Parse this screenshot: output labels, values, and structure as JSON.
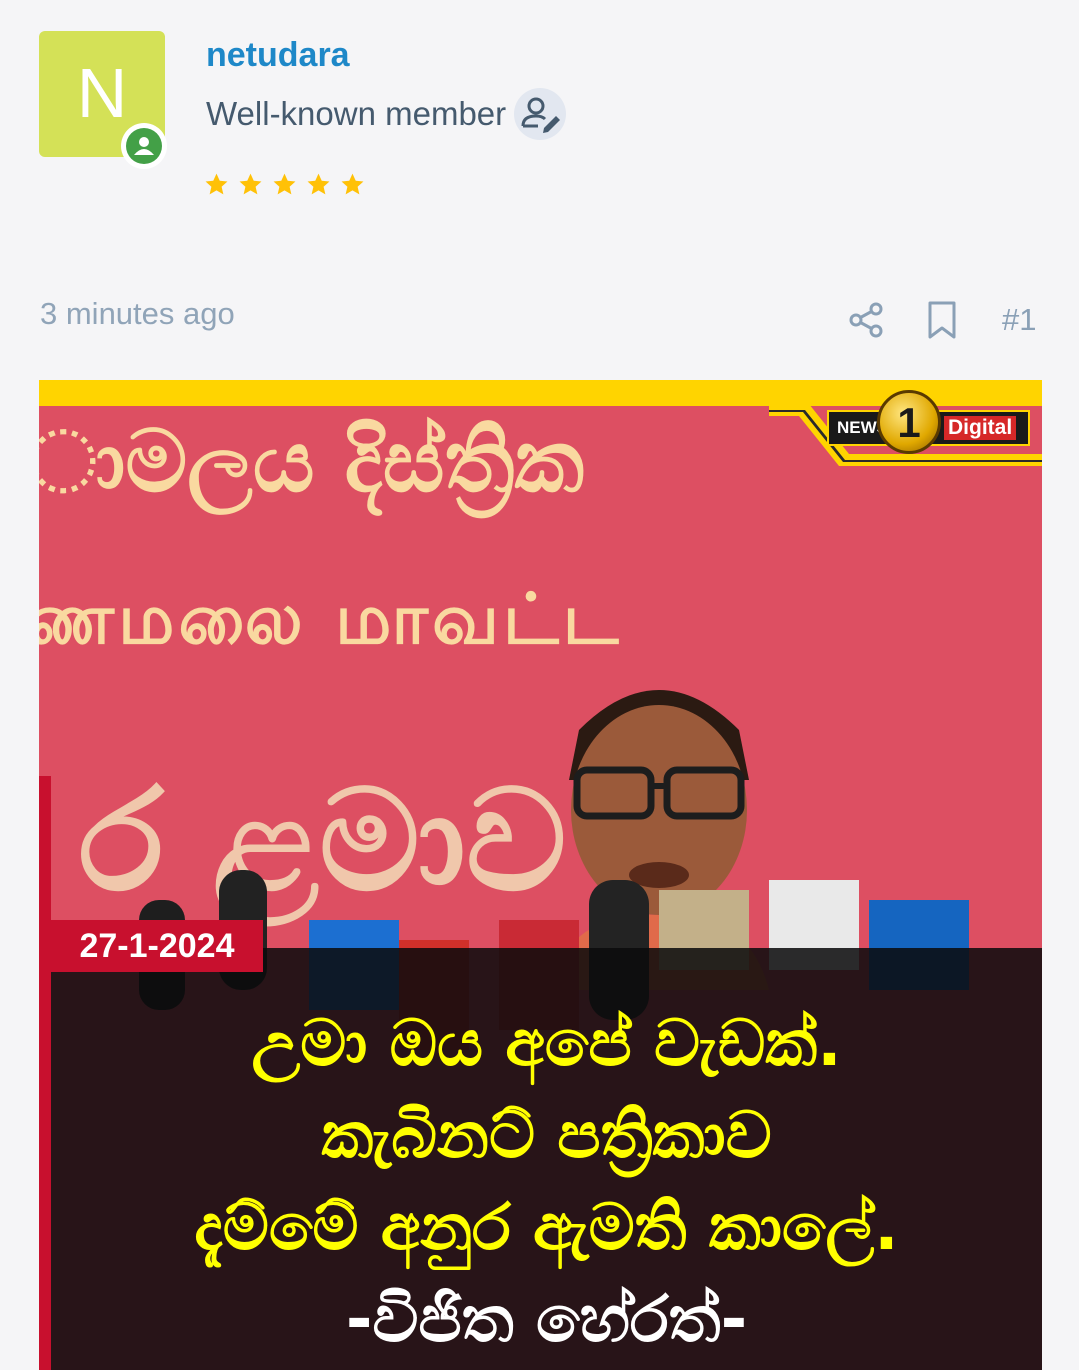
{
  "user": {
    "avatar_letter": "N",
    "name": "netudara",
    "title": "Well-known member",
    "rating_stars": 5
  },
  "post": {
    "time": "3 minutes ago",
    "number": "#1"
  },
  "news_image": {
    "logo_left": "NEWS",
    "logo_number": "1",
    "logo_right": "Digital",
    "banner_line1": "ාමලය දිස්ත්‍රික",
    "banner_line2": "ணமலை மாவட்ட",
    "banner_line3": "ර ළමාව",
    "date": "27-1-2024",
    "caption_line1": "උමා ඔය අපේ වැඩක්.",
    "caption_line2": "කැබිනට් පත්‍රිකාව",
    "caption_line3": "දැම්මේ අනුර ඇමති කාලේ.",
    "caption_line4": "-විජිත හේරත්-"
  },
  "colors": {
    "username": "#1e88c8",
    "avatar_bg": "#d4e157",
    "star": "#ffc107",
    "online": "#43a047",
    "caption_text": "#ffff00",
    "date_bg": "#c8102e"
  }
}
